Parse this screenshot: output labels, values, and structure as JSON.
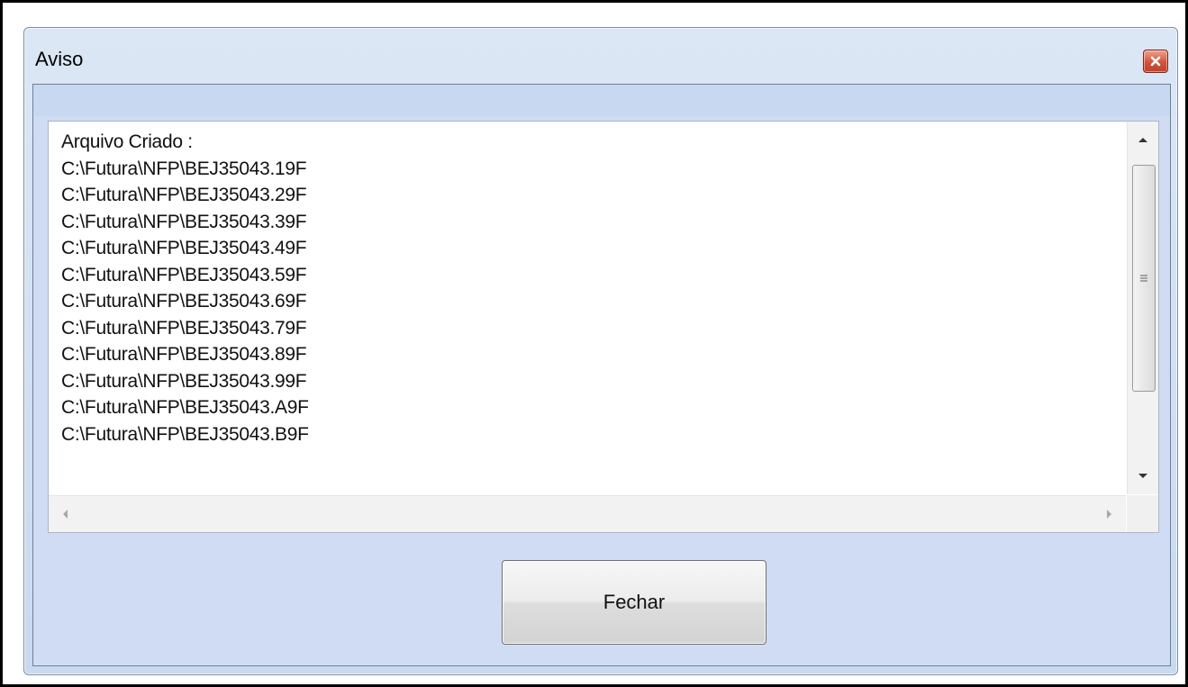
{
  "window": {
    "title": "Aviso"
  },
  "memo": {
    "lines": [
      "Arquivo Criado :",
      "C:\\Futura\\NFP\\BEJ35043.19F",
      "C:\\Futura\\NFP\\BEJ35043.29F",
      "C:\\Futura\\NFP\\BEJ35043.39F",
      "C:\\Futura\\NFP\\BEJ35043.49F",
      "C:\\Futura\\NFP\\BEJ35043.59F",
      "C:\\Futura\\NFP\\BEJ35043.69F",
      "C:\\Futura\\NFP\\BEJ35043.79F",
      "C:\\Futura\\NFP\\BEJ35043.89F",
      "C:\\Futura\\NFP\\BEJ35043.99F",
      "C:\\Futura\\NFP\\BEJ35043.A9F",
      "C:\\Futura\\NFP\\BEJ35043.B9F"
    ]
  },
  "buttons": {
    "close_label": "Fechar"
  },
  "icons": {
    "close": "close-icon",
    "scroll_up": "chevron-up-icon",
    "scroll_down": "chevron-down-icon",
    "scroll_left": "chevron-left-icon",
    "scroll_right": "chevron-right-icon",
    "grip": "grip-icon"
  },
  "colors": {
    "window_background": "#cfdcf3",
    "close_button": "#d0543a"
  }
}
